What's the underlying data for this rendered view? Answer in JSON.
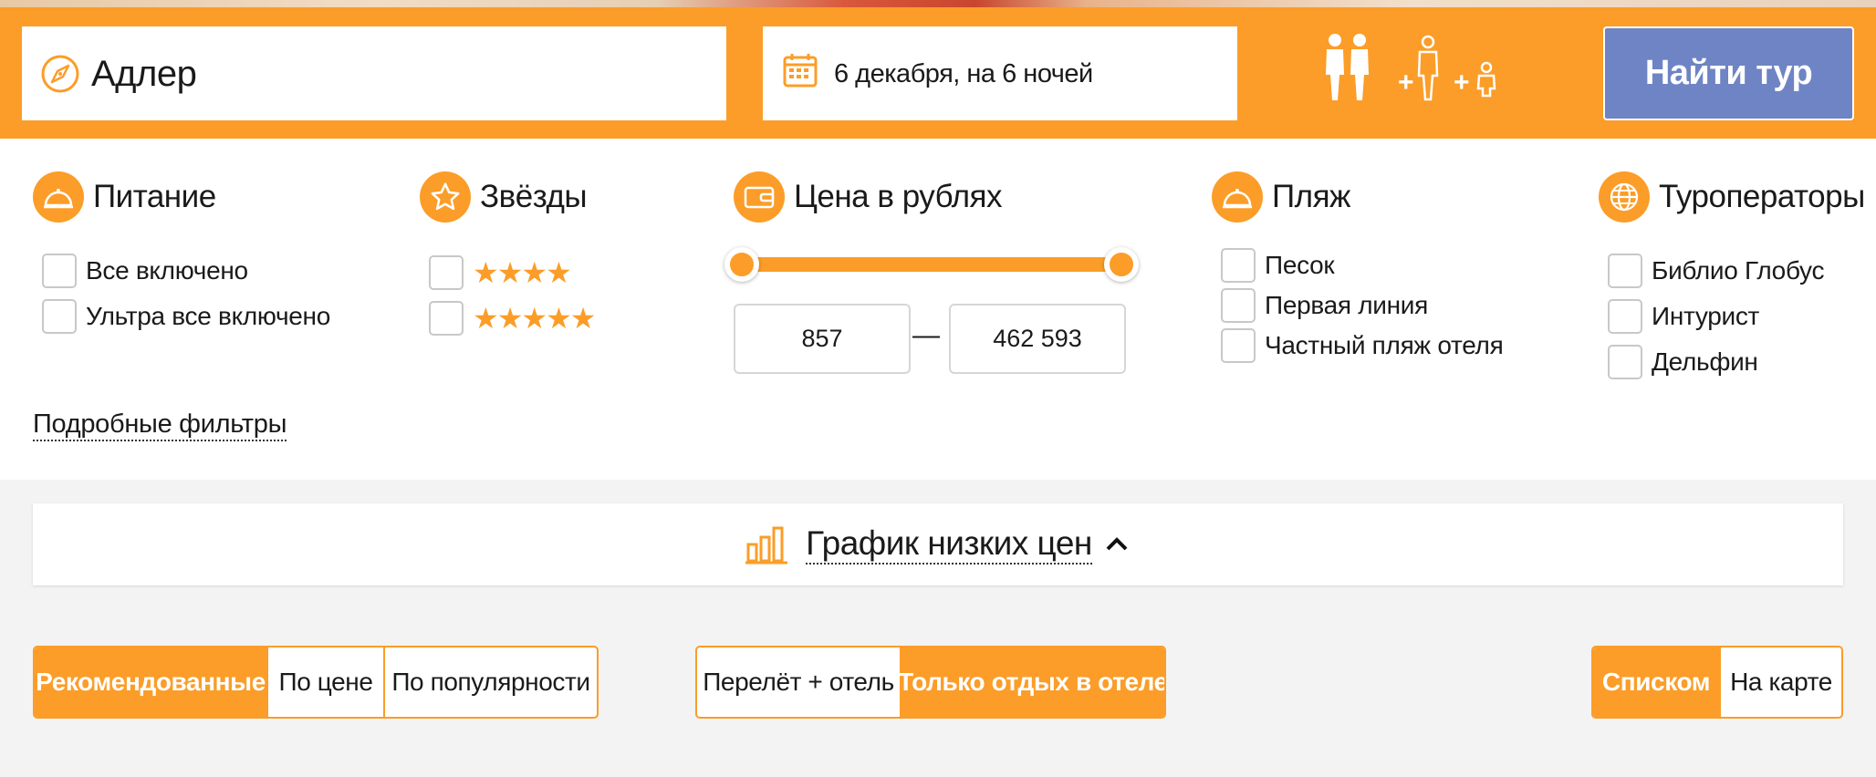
{
  "search": {
    "destination": "Адлер",
    "date": "6 декабря, на 6 ночей",
    "find_button": "Найти тур",
    "tourist_plus_child": "+",
    "tourist_plus_infant": "+"
  },
  "filters": {
    "food": {
      "title": "Питание",
      "options": [
        "Все включено",
        "Ультра все включено"
      ]
    },
    "stars": {
      "title": "Звёзды",
      "options": [
        "★★★★",
        "★★★★★"
      ]
    },
    "price": {
      "title": "Цена в рублях",
      "min": "857",
      "max": "462 593",
      "separator": "—",
      "range_fraction": [
        0.0,
        1.0
      ]
    },
    "beach": {
      "title": "Пляж",
      "options": [
        "Песок",
        "Первая линия",
        "Частный пляж отеля"
      ]
    },
    "operators": {
      "title": "Туроператоры",
      "options": [
        "Библио Глобус",
        "Интурист",
        "Дельфин"
      ]
    },
    "more_link": "Подробные фильтры"
  },
  "chart_toggle": {
    "label": "График низких цен"
  },
  "sort": {
    "options": [
      "Рекомендованные",
      "По цене",
      "По популярности"
    ],
    "active": "Рекомендованные"
  },
  "tour_type": {
    "options": [
      "Перелёт + отель",
      "Только отдых в отеле"
    ],
    "active": "Только отдых в отеле"
  },
  "view": {
    "options": [
      "Списком",
      "На карте"
    ],
    "active": "Списком"
  },
  "colors": {
    "accent": "#fb9d28",
    "button": "#6e84c4"
  }
}
